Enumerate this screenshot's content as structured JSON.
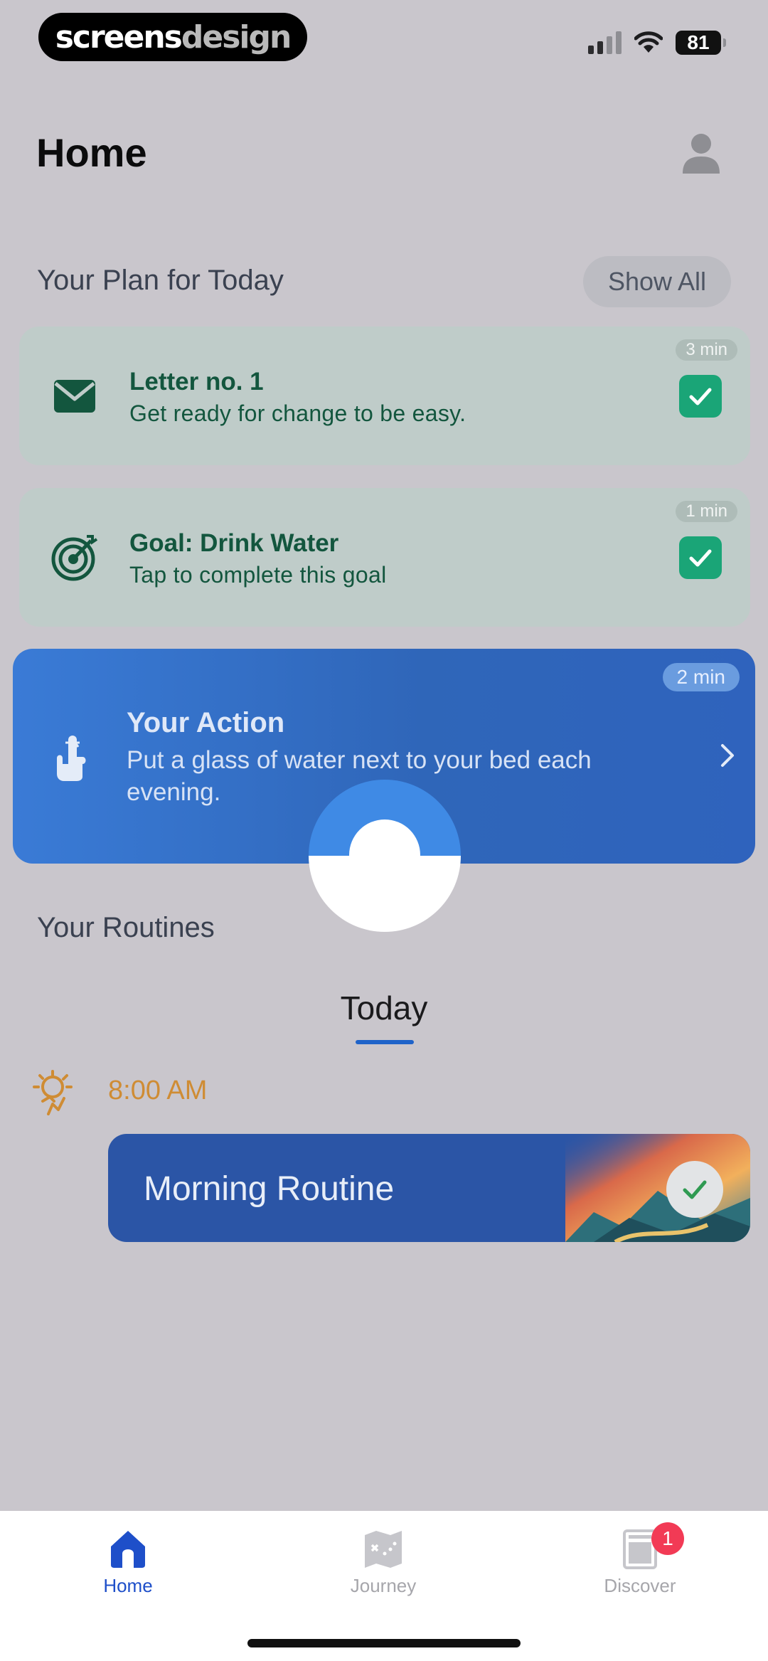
{
  "status_bar": {
    "brand_part1": "screens",
    "brand_part2": "design",
    "battery": "81",
    "icons": [
      "cellular-signal-icon",
      "wifi-icon",
      "battery-icon"
    ]
  },
  "header": {
    "title": "Home",
    "profile_icon": "person-icon"
  },
  "plan": {
    "section_title": "Your Plan for Today",
    "show_all_label": "Show All",
    "items": [
      {
        "icon": "envelope-icon",
        "title": "Letter no. 1",
        "subtitle": "Get ready for change to be easy.",
        "duration": "3 min",
        "completed": true
      },
      {
        "icon": "target-icon",
        "title": "Goal: Drink Water",
        "subtitle": "Tap to complete this goal",
        "duration": "1 min",
        "completed": true
      }
    ],
    "action": {
      "icon": "finger-string-icon",
      "title": "Your Action",
      "subtitle": "Put a glass of water next to your bed each evening.",
      "duration": "2 min"
    }
  },
  "routines": {
    "section_title": "Your Routines",
    "tab_label": "Today",
    "time_icon": "sun-morning-icon",
    "time": "8:00 AM",
    "card": {
      "title": "Morning Routine",
      "completed": true
    }
  },
  "tabbar": {
    "tabs": [
      {
        "label": "Home",
        "icon": "home-icon",
        "active": true
      },
      {
        "label": "Journey",
        "icon": "map-icon",
        "active": false
      },
      {
        "label": "Discover",
        "icon": "discover-icon",
        "active": false,
        "badge": "1"
      }
    ]
  },
  "colors": {
    "overlay_background": "#c9c6cc",
    "plan_card": "#bfccc9",
    "plan_text": "#13563e",
    "check_green": "#1aa577",
    "action_blue": "#3a7bd6",
    "routine_blue": "#2b55a6",
    "time_orange": "#cf8c34",
    "active_tab": "#1e4fc9",
    "badge_red": "#f23a55"
  }
}
